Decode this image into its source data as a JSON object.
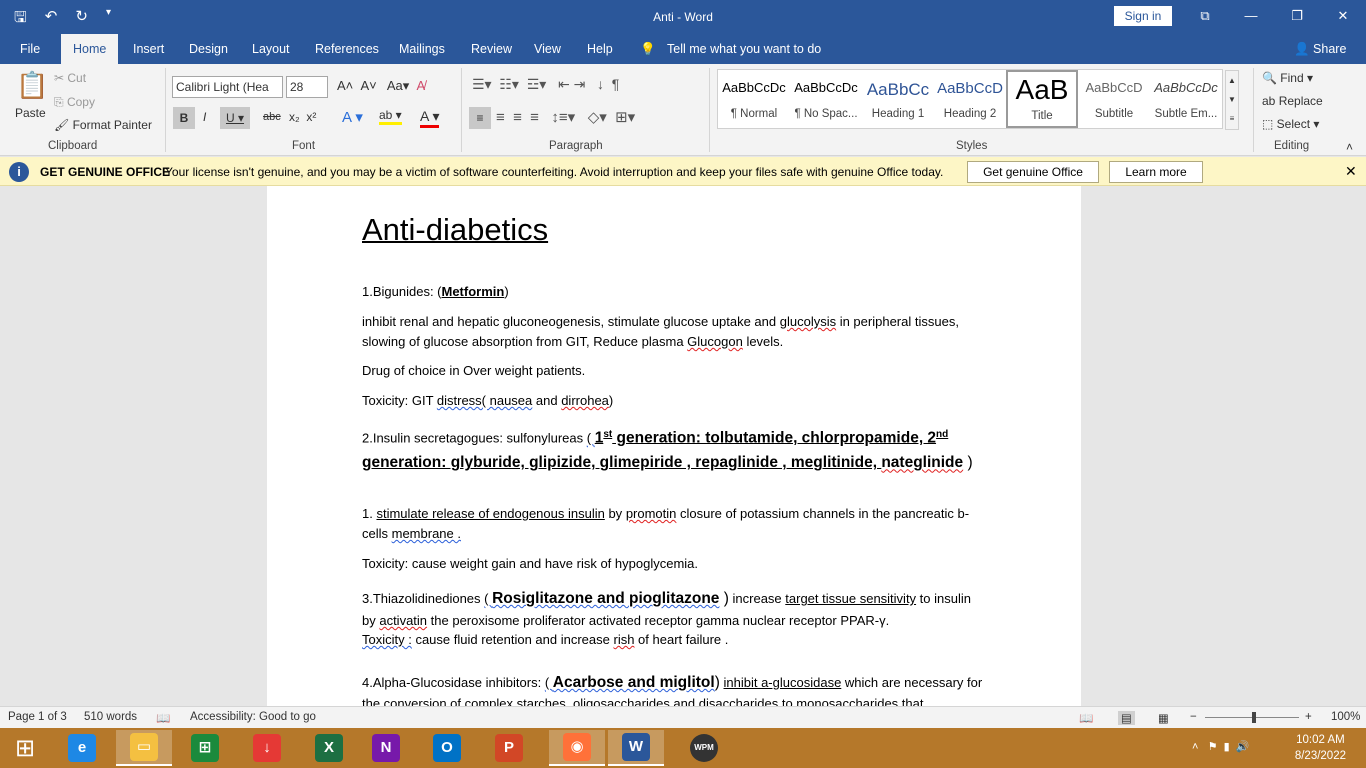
{
  "window": {
    "title": "Anti  -  Word",
    "sign_in": "Sign in",
    "share": "Share"
  },
  "tabs": [
    "File",
    "Home",
    "Insert",
    "Design",
    "Layout",
    "References",
    "Mailings",
    "Review",
    "View",
    "Help"
  ],
  "tell_me": "Tell me what you want to do",
  "clipboard": {
    "paste": "Paste",
    "cut": "Cut",
    "copy": "Copy",
    "format_painter": "Format Painter",
    "label": "Clipboard"
  },
  "font": {
    "name": "Calibri Light (Hea",
    "size": "28",
    "label": "Font"
  },
  "paragraph": {
    "label": "Paragraph"
  },
  "styles": {
    "label": "Styles",
    "items": [
      {
        "preview": "AaBbCcDc",
        "name": "¶ Normal"
      },
      {
        "preview": "AaBbCcDc",
        "name": "¶ No Spac..."
      },
      {
        "preview": "AaBbCc",
        "name": "Heading 1"
      },
      {
        "preview": "AaBbCcD",
        "name": "Heading 2"
      },
      {
        "preview": "AaB",
        "name": "Title",
        "selected": true
      },
      {
        "preview": "AaBbCcD",
        "name": "Subtitle"
      },
      {
        "preview": "AaBbCcDc",
        "name": "Subtle Em..."
      }
    ]
  },
  "editing": {
    "find": "Find",
    "replace": "Replace",
    "select": "Select",
    "label": "Editing"
  },
  "message": {
    "title": "GET GENUINE OFFICE",
    "text": "Your license isn't genuine, and you may be a victim of software counterfeiting. Avoid interruption and keep your files safe with genuine Office today.",
    "btn1": "Get genuine Office",
    "btn2": "Learn more"
  },
  "document": {
    "heading": "Anti-diabetics",
    "paragraphs": [
      [
        {
          "t": "1.Bigunides: ("
        },
        {
          "t": "Metformin",
          "s": "b u"
        },
        {
          "t": ")"
        }
      ],
      [
        {
          "t": "  inhibit renal and hepatic gluconeogenesis, stimulate glucose uptake and "
        },
        {
          "t": "glucolysis",
          "s": "sq"
        },
        {
          "t": " in peripheral tissues, slowing of glucose absorption from GIT, Reduce plasma "
        },
        {
          "t": "Glucogon",
          "s": "sq"
        },
        {
          "t": " levels."
        }
      ],
      [
        {
          "t": "Drug of choice in Over weight patients."
        }
      ],
      [
        {
          "t": "Toxicity: GIT "
        },
        {
          "t": "distress( nausea",
          "s": "sqb"
        },
        {
          "t": " and "
        },
        {
          "t": "dirrohea",
          "s": "sq"
        },
        {
          "t": ")"
        }
      ],
      [
        {
          "t": "2.Insulin secretagogues: sulfonylureas "
        },
        {
          "t": "( ",
          "s": "sqb"
        },
        {
          "t": "1",
          "s": "big u"
        },
        {
          "t": "st",
          "s": "sup b"
        },
        {
          "t": " generation: tolbutamide, chlorpropamide,  2",
          "s": "big u"
        },
        {
          "t": "nd",
          "s": "sup b"
        },
        {
          "t": " generation: glyburide, glipizide, glimepiride , repaglinide , meglitinide, ",
          "s": "big u"
        },
        {
          "t": "nateglinide",
          "s": "big sq"
        },
        {
          "t": " )",
          "s": "bigr"
        }
      ],
      [
        {
          "t": "               1. "
        },
        {
          "t": "stimulate release of endogenous insulin",
          "s": "u"
        },
        {
          "t": " by "
        },
        {
          "t": "promotin",
          "s": "sq"
        },
        {
          "t": " closure of potassium channels in the pancreatic b-cells "
        },
        {
          "t": "membrane .",
          "s": "sqb"
        }
      ],
      [
        {
          "t": "Toxicity: cause weight gain and have risk of hypoglycemia."
        }
      ],
      [
        {
          "t": "3.Thiazolidinediones "
        },
        {
          "t": "( ",
          "s": "sqb"
        },
        {
          "t": "Rosiglitazone and pioglitazone",
          "s": "big sqb"
        },
        {
          "t": " )",
          "s": "bigr"
        },
        {
          "t": " increase "
        },
        {
          "t": "target tissue sensitivity",
          "s": "u"
        },
        {
          "t": " to insulin by "
        },
        {
          "t": "activatin",
          "s": "sq"
        },
        {
          "t": " the peroxisome proliferator activated receptor gamma nuclear receptor PPAR-γ."
        }
      ],
      [
        {
          "t": "Toxicity :",
          "s": "sqb"
        },
        {
          "t": " cause fluid retention and increase "
        },
        {
          "t": "rish",
          "s": "sq"
        },
        {
          "t": " of heart failure ."
        }
      ],
      [
        {
          "t": "4.Alpha-Glucosidase inhibitors: "
        },
        {
          "t": "( ",
          "s": "sqb"
        },
        {
          "t": "Acarbose and miglitol",
          "s": "big sqb"
        },
        {
          "t": ")",
          "s": "bigr"
        },
        {
          "t": " "
        },
        {
          "t": "inhibit a-glucosidase",
          "s": "u"
        },
        {
          "t": " which are necessary for the conversion of complex  starches, oligosaccharides and disaccharides to monosaccharides that"
        }
      ]
    ]
  },
  "status": {
    "page": "Page 1 of 3",
    "words": "510 words",
    "accessibility": "Accessibility: Good to go",
    "zoom": "100%"
  },
  "taskbar": {
    "time": "10:02 AM",
    "date": "8/23/2022",
    "apps": [
      {
        "name": "internet-explorer",
        "label": "e",
        "color": "#1e88e5"
      },
      {
        "name": "file-explorer",
        "label": "▭",
        "color": "#f4c041",
        "active": true
      },
      {
        "name": "store",
        "label": "⊞",
        "color": "#1b8a3c"
      },
      {
        "name": "downloader",
        "label": "↓",
        "color": "#e53935"
      },
      {
        "name": "excel",
        "label": "X",
        "color": "#1d6f42"
      },
      {
        "name": "onenote",
        "label": "N",
        "color": "#7719aa"
      },
      {
        "name": "outlook",
        "label": "O",
        "color": "#0072c6"
      },
      {
        "name": "powerpoint",
        "label": "P",
        "color": "#d24726"
      },
      {
        "name": "firefox",
        "label": "◉",
        "color": "#ff7139",
        "active": true
      },
      {
        "name": "word",
        "label": "W",
        "color": "#2b579a",
        "active": true
      },
      {
        "name": "wpm",
        "label": "WPM",
        "color": "#333"
      }
    ]
  }
}
